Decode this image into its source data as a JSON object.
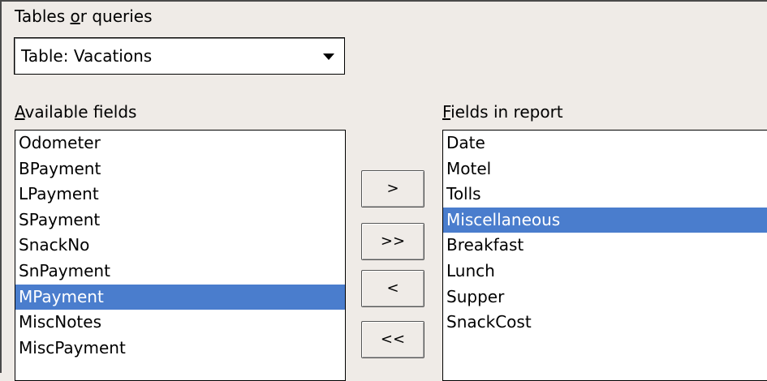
{
  "tables_label_pre": "Tables ",
  "tables_label_mnemonic": "o",
  "tables_label_post": "r queries",
  "table_select": {
    "value": "Table: Vacations"
  },
  "available": {
    "label_mnemonic": "A",
    "label_rest": "vailable fields",
    "items": [
      "Odometer",
      "BPayment",
      "LPayment",
      "SPayment",
      "SnackNo",
      "SnPayment",
      "MPayment",
      "MiscNotes",
      "MiscPayment"
    ],
    "selected": "MPayment"
  },
  "report": {
    "label_mnemonic": "F",
    "label_rest": "ields in report",
    "items": [
      "Date",
      "Motel",
      "Tolls",
      "Miscellaneous",
      "Breakfast",
      "Lunch",
      "Supper",
      "SnackCost"
    ],
    "selected": "Miscellaneous"
  },
  "buttons": {
    "add": ">",
    "add_all": ">>",
    "remove": "<",
    "remove_all": "<<"
  },
  "colors": {
    "selection": "#4a7dcd",
    "background": "#efebe7"
  }
}
